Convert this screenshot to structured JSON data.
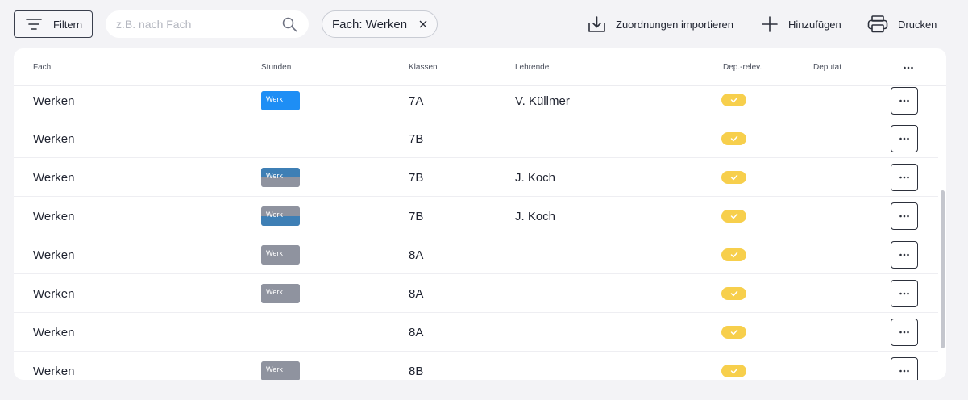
{
  "toolbar": {
    "filter_label": "Filtern",
    "search_placeholder": "z.B. nach Fach",
    "search_value": "",
    "chip_label": "Fach: Werken",
    "import_label": "Zuordnungen importieren",
    "add_label": "Hinzufügen",
    "print_label": "Drucken"
  },
  "table": {
    "headers": {
      "fach": "Fach",
      "stunden": "Stunden",
      "klassen": "Klassen",
      "lehrende": "Lehrende",
      "deprelev": "Dep.-relev.",
      "deputat": "Deputat"
    },
    "rows": [
      {
        "fach": "Werken",
        "badge": "Werk",
        "top_color": "#1e8ef5",
        "bot_color": "#1e8ef5",
        "klasse": "7A",
        "lehrende": "V. Küllmer"
      },
      {
        "fach": "Werken",
        "badge": "",
        "top_color": "",
        "bot_color": "",
        "klasse": "7B",
        "lehrende": ""
      },
      {
        "fach": "Werken",
        "badge": "Werk",
        "top_color": "#3e7fb5",
        "bot_color": "#8f939f",
        "klasse": "7B",
        "lehrende": "J. Koch"
      },
      {
        "fach": "Werken",
        "badge": "Werk",
        "top_color": "#8f939f",
        "bot_color": "#3e7fb5",
        "klasse": "7B",
        "lehrende": "J. Koch"
      },
      {
        "fach": "Werken",
        "badge": "Werk",
        "top_color": "#8f939f",
        "bot_color": "#8f939f",
        "klasse": "8A",
        "lehrende": ""
      },
      {
        "fach": "Werken",
        "badge": "Werk",
        "top_color": "#8f939f",
        "bot_color": "#8f939f",
        "klasse": "8A",
        "lehrende": ""
      },
      {
        "fach": "Werken",
        "badge": "",
        "top_color": "",
        "bot_color": "",
        "klasse": "8A",
        "lehrende": ""
      },
      {
        "fach": "Werken",
        "badge": "Werk",
        "top_color": "#8f939f",
        "bot_color": "#8f939f",
        "klasse": "8B",
        "lehrende": ""
      }
    ]
  },
  "colors": {
    "accent_blue": "#1e8ef5",
    "check_pill": "#f7cf4c",
    "badge_gray": "#8f939f"
  }
}
